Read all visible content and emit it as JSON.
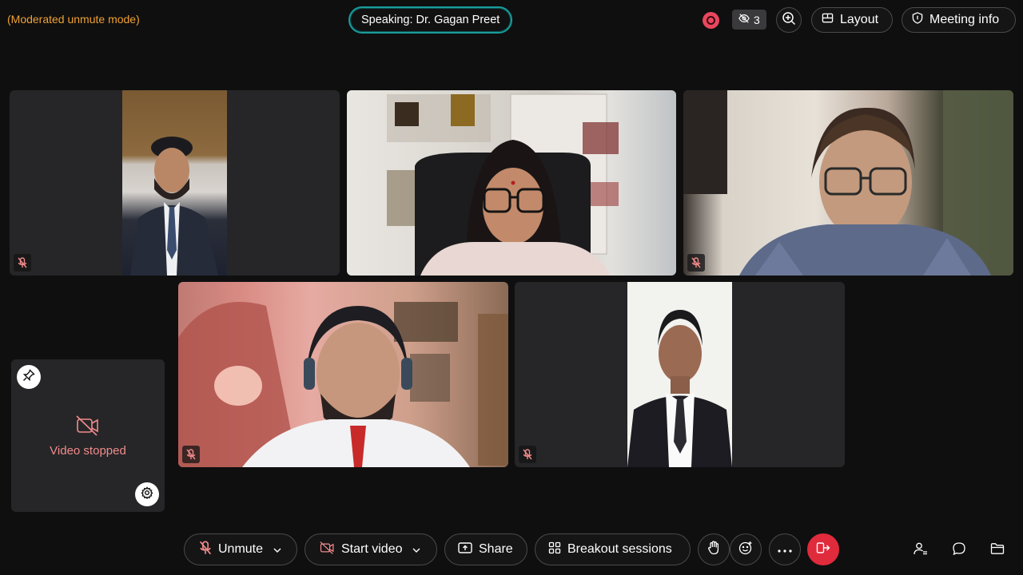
{
  "header": {
    "mode_text": "(Moderated unmute mode)",
    "speaking_text": "Speaking: Dr. Gagan Preet",
    "hidden_participants_count": "3",
    "layout_label": "Layout",
    "meeting_info_label": "Meeting info"
  },
  "stopped_tile": {
    "label": "Video stopped"
  },
  "toolbar": {
    "unmute_label": "Unmute",
    "start_video_label": "Start video",
    "share_label": "Share",
    "breakout_label": "Breakout sessions"
  },
  "colors": {
    "mode_text": "#f0a033",
    "speaking_border": "#1a9b9b",
    "recording": "#e8475e",
    "leave": "#e02b3c",
    "video_stopped": "#f28b8b"
  }
}
